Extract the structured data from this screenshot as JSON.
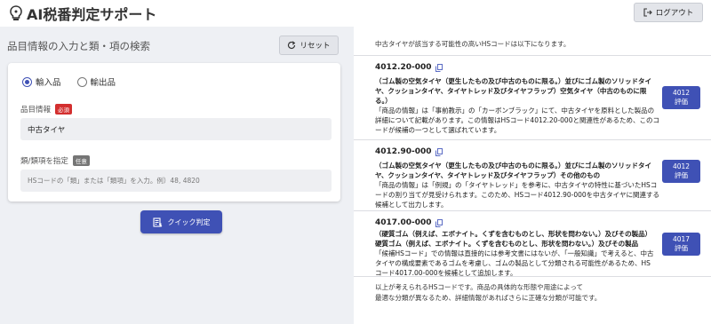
{
  "app": {
    "title": "AI税番判定サポート",
    "logout_label": "ログアウト"
  },
  "left": {
    "section_title": "品目情報の入力と類・項の検索",
    "reset_label": "リセット",
    "radio": {
      "import_label": "輸入品",
      "export_label": "輸出品",
      "selected": "import"
    },
    "item_field": {
      "label": "品目情報",
      "badge": "必須",
      "value": "中古タイヤ"
    },
    "class_field": {
      "label": "類/類項を指定",
      "badge": "任意",
      "placeholder": "HSコードの「類」または「類項」を入力。例）48, 4820"
    },
    "quick_label": "クイック判定"
  },
  "right": {
    "intro": "中古タイヤが該当する可能性の高いHSコードは以下になります。",
    "results": [
      {
        "code": "4012.20-000",
        "title_lines": [
          "（ゴム製の空気タイヤ（更生したもの及び中古のものに限る。）並びにゴム製のソリッドタイ",
          "ヤ、クッションタイヤ、タイヤトレッド及びタイヤフラップ）空気タイヤ（中古のものに限",
          "る。）"
        ],
        "body_lines": [
          "「商品の情報」は「事前教示」の「カーボンブラック」にて、中古タイヤを原料とした製品の",
          "詳細について記載があります。この情報はHSコード4012.20-000と関連性があるため、このコ",
          "ードが候補の一つとして選ばれています。"
        ],
        "eval_line1": "4012",
        "eval_line2": "評価"
      },
      {
        "code": "4012.90-000",
        "title_lines": [
          "（ゴム製の空気タイヤ（更生したもの及び中古のものに限る。）並びにゴム製のソリッドタイ",
          "ヤ、クッションタイヤ、タイヤトレッド及びタイヤフラップ）その他のもの"
        ],
        "body_lines": [
          "「商品の情報」は「例規」の「タイヤトレッド」を参考に、中古タイヤの特性に基づいたHSコ",
          "ードの割り当てが見受けられます。このため、HSコード4012.90-000を中古タイヤに関連する",
          "候補として出力します。"
        ],
        "eval_line1": "4012",
        "eval_line2": "評価"
      },
      {
        "code": "4017.00-000",
        "title_lines": [
          "（硬質ゴム（例えば、エボナイト。くずを含むものとし、形状を問わない。）及びその製品）",
          "硬質ゴム（例えば、エボナイト。くずを含むものとし、形状を問わない。）及びその製品"
        ],
        "body_lines": [
          "「候補HSコード」での情報は直接的には参考文書にはないが、「一般知識」で考えると、中古",
          "タイヤの構成要素であるゴムを考慮し、ゴムの製品として分類される可能性があるため、HS",
          "コード4017.00-000を候補として追加します。"
        ],
        "eval_line1": "4017",
        "eval_line2": "評価"
      }
    ],
    "footer_lines": [
      "以上が考えられるHSコードです。商品の具体的な形態や用途によって",
      "最適な分類が異なるため、詳細情報があればさらに正確な分類が可能です。"
    ]
  },
  "colors": {
    "accent": "#3f51b5",
    "required_badge": "#d32f2f",
    "optional_badge": "#757575"
  },
  "icons": [
    "bulb-logo-icon",
    "logout-icon",
    "reset-icon",
    "copy-icon",
    "quick-check-icon"
  ]
}
